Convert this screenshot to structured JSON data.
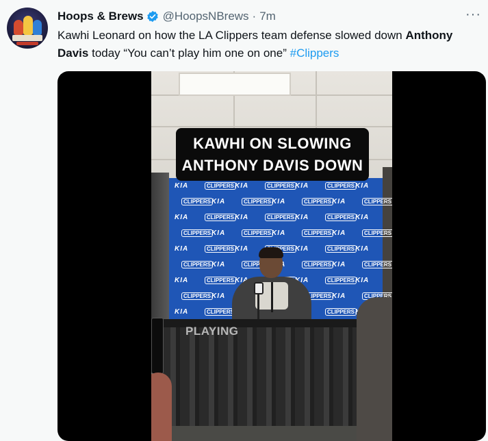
{
  "tweet": {
    "author_name": "Hoops & Brews",
    "handle": "@HoopsNBrews",
    "separator": "·",
    "time": "7m",
    "more_label": "···",
    "text_part1": "Kawhi Leonard on how the LA Clippers team defense slowed down ",
    "text_bold": "Anthony Davis",
    "text_part2": " today “You can’t play him one on one” ",
    "hashtag": "#Clippers",
    "verified_color": "#1d9bf0",
    "hashtag_color": "#1d9bf0"
  },
  "video": {
    "caption_line1": "KAWHI ON SLOWING",
    "caption_line2": "ANTHONY DAVIS DOWN",
    "status_overlay": "PLAYING",
    "backdrop_logo_a": "KIA",
    "backdrop_logo_b": "CLIPPERS",
    "backdrop_color": "#1f56b6"
  }
}
